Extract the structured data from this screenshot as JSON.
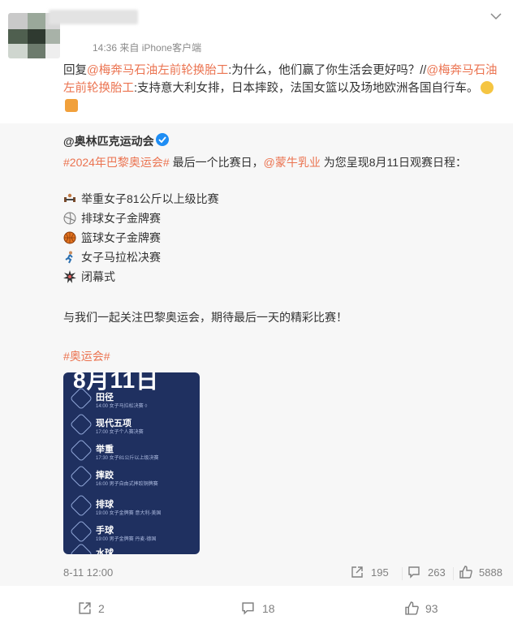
{
  "post": {
    "meta": "14:36 来自 iPhone客户端",
    "reply_prefix": "回复",
    "reply_mention": "@梅奔马石油左前轮换胎工",
    "reply_text": ":为什么，他们赢了你生活会更好吗？//",
    "repost_mention": "@梅奔马石油左前轮换胎工",
    "repost_text": ":支持意大利女排，日本摔跤，法国女篮以及场地欧洲各国自行车。"
  },
  "repost": {
    "author": "@奥林匹克运动会",
    "topic": "#2024年巴黎奥运会#",
    "text1": " 最后一个比赛日，",
    "sponsor": "@蒙牛乳业",
    "text2": " 为您呈现8月11日观赛日程：",
    "schedule": [
      {
        "icon": "weightlifting-icon",
        "label": "举重女子81公斤以上级比赛"
      },
      {
        "icon": "volleyball-icon",
        "label": "排球女子金牌赛"
      },
      {
        "icon": "basketball-icon",
        "label": "篮球女子金牌赛"
      },
      {
        "icon": "marathon-runner-icon",
        "label": "女子马拉松决赛"
      },
      {
        "icon": "closing-ceremony-icon",
        "label": "闭幕式"
      }
    ],
    "closing": "与我们一起关注巴黎奥运会，期待最后一天的精彩比赛！",
    "hashtag": "#奥运会#",
    "poster": {
      "date": "8月11日",
      "events": [
        {
          "sport": "田径",
          "detail": "14:00 女子马拉松决赛 ◊"
        },
        {
          "sport": "现代五项",
          "detail": "17:00 女子个人赛决赛"
        },
        {
          "sport": "举重",
          "detail": "17:30 女子81公斤以上级决赛"
        },
        {
          "sport": "摔跤",
          "detail": "16:00 男子自由式摔跤铜牌赛"
        },
        {
          "sport": "排球",
          "detail": "19:00 女子金牌赛 意大利-美国"
        },
        {
          "sport": "手球",
          "detail": "19:00 男子金牌赛 丹麦-德国"
        },
        {
          "sport": "水球",
          "detail": ""
        }
      ]
    },
    "footer": {
      "date": "8-11 12:00",
      "reposts": "195",
      "comments": "263",
      "likes": "5888"
    }
  },
  "footer": {
    "reposts": "2",
    "comments": "18",
    "likes": "93"
  },
  "colors": {
    "accent": "#eb7350",
    "verified": "#1e8df4",
    "poster_bg": "#1f3060"
  }
}
